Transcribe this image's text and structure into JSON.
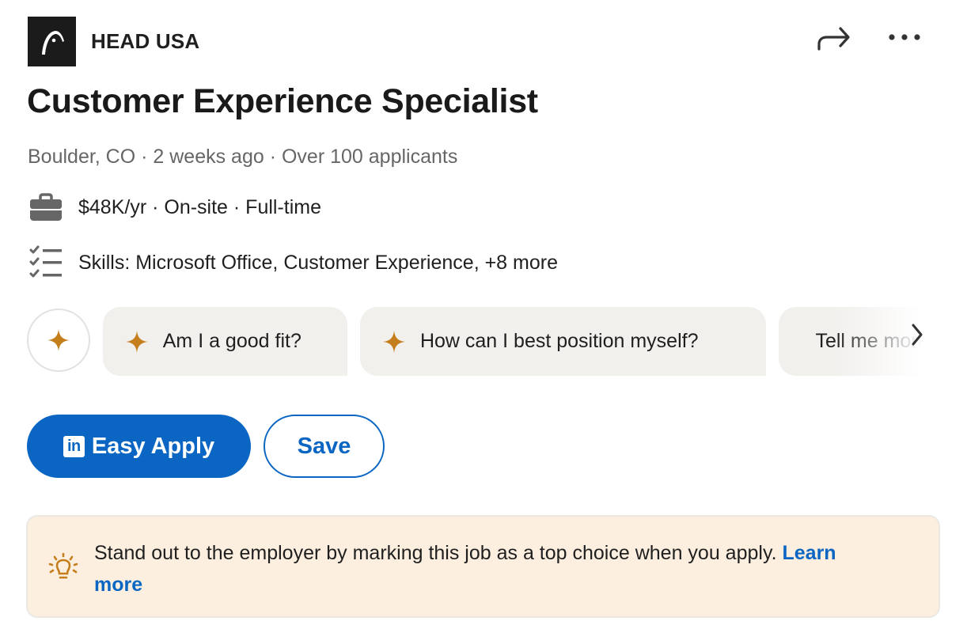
{
  "header": {
    "company": "HEAD USA",
    "logo_icon": "head-logo-icon",
    "actions": [
      {
        "name": "share",
        "icon": "share-arrow-icon"
      },
      {
        "name": "more",
        "icon": "more-dots-icon"
      }
    ]
  },
  "job": {
    "title": "Customer Experience Specialist",
    "meta": "Boulder, CO · 2 weeks ago · Over 100 applicants",
    "salary_line": "$48K/yr · On-site · Full-time",
    "skills_line": "Skills: Microsoft Office, Customer Experience, +8 more"
  },
  "prompts": {
    "chips": [
      {
        "label": "Am I a good fit?"
      },
      {
        "label": "How can I best position myself?"
      },
      {
        "label": "Tell me more"
      }
    ],
    "next_icon": "chevron-right-icon"
  },
  "actions": {
    "apply_label": "Easy Apply",
    "apply_logo": "in",
    "save_label": "Save"
  },
  "banner": {
    "text": "Stand out to the employer by marking this job as a top choice when you apply.",
    "link": "Learn more"
  },
  "colors": {
    "brand_blue": "#0a66c2",
    "spark": "#c47f1c",
    "banner_bg": "#fcefdf",
    "chip_bg": "#f2f0ed"
  }
}
